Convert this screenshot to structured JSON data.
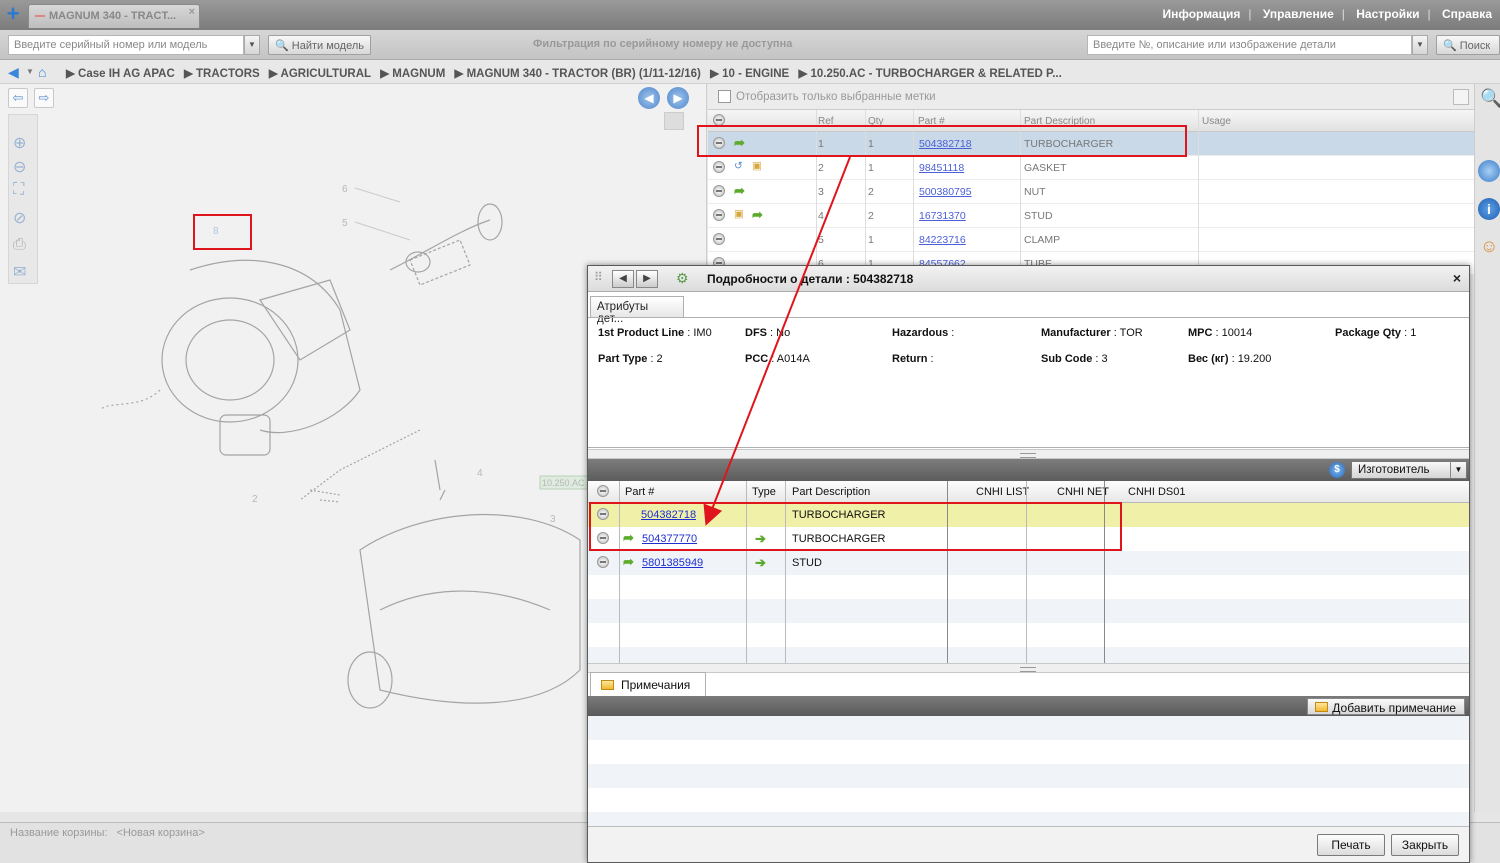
{
  "tab": {
    "title": "MAGNUM 340 - TRACT...",
    "close": "×"
  },
  "topnav": [
    "Информация",
    "Управление",
    "Настройки",
    "Справка"
  ],
  "search": {
    "serial_placeholder": "Введите серийный номер или модель",
    "find_model": "Найти модель",
    "filter_msg": "Фильтрация по серийному номеру не доступна",
    "part_placeholder": "Введите №, описание или изображение детали",
    "search_btn": "Поиск"
  },
  "breadcrumb": [
    "Case IH AG APAC",
    "TRACTORS",
    "AGRICULTURAL",
    "MAGNUM",
    "MAGNUM 340 - TRACTOR (BR) (1/11-12/16)",
    "10 - ENGINE",
    "10.250.AC - TURBOCHARGER & RELATED P..."
  ],
  "parts_list": {
    "checkbox_label": "Отобразить только выбранные метки",
    "columns": [
      "Ref",
      "Qty",
      "Part #",
      "Part Description",
      "Usage"
    ],
    "rows": [
      {
        "ref": "1",
        "qty": "1",
        "part": "504382718",
        "desc": "TURBOCHARGER"
      },
      {
        "ref": "2",
        "qty": "1",
        "part": "98451118",
        "desc": "GASKET"
      },
      {
        "ref": "3",
        "qty": "2",
        "part": "500380795",
        "desc": "NUT"
      },
      {
        "ref": "4",
        "qty": "2",
        "part": "16731370",
        "desc": "STUD"
      },
      {
        "ref": "5",
        "qty": "1",
        "part": "84223716",
        "desc": "CLAMP"
      },
      {
        "ref": "6",
        "qty": "1",
        "part": "84557662",
        "desc": "TUBE"
      }
    ]
  },
  "drawing": {
    "callouts": [
      "6",
      "5",
      "4",
      "2",
      "3"
    ],
    "label_tag": "10.250.AC",
    "marker": "8"
  },
  "basket": {
    "label": "Название корзины:",
    "value": "<Новая корзина>"
  },
  "dialog": {
    "title": "Подробности о детали : 504382718",
    "close": "×",
    "attr_tab": "Атрибуты дет...",
    "attributes": [
      {
        "label": "1st Product Line",
        "value": "IM0"
      },
      {
        "label": "DFS",
        "value": "No"
      },
      {
        "label": "Hazardous",
        "value": ""
      },
      {
        "label": "Manufacturer",
        "value": "TOR"
      },
      {
        "label": "MPC",
        "value": "10014"
      },
      {
        "label": "Package Qty",
        "value": "1"
      },
      {
        "label": "Part Type",
        "value": "2"
      },
      {
        "label": "PCC",
        "value": "A014A"
      },
      {
        "label": "Return",
        "value": ""
      },
      {
        "label": "Sub Code",
        "value": "3"
      },
      {
        "label": "Вес (кг)",
        "value": "19.200"
      }
    ],
    "manufacturer_select": "Изготовитель",
    "currency_icon": "$",
    "columns": [
      "Part #",
      "Type",
      "Part Description",
      "CNHI LIST",
      "CNHI NET",
      "CNHI DS01"
    ],
    "rows": [
      {
        "part": "504382718",
        "desc": "TURBOCHARGER",
        "highlight": true
      },
      {
        "part": "504377770",
        "desc": "TURBOCHARGER",
        "highlight": false
      },
      {
        "part": "5801385949",
        "desc": "STUD",
        "highlight": false
      }
    ],
    "notes_tab": "Примечания",
    "add_note": "Добавить примечание",
    "print": "Печать",
    "close_btn": "Закрыть"
  },
  "colors": {
    "highlight_row": "#f0f0a8",
    "selected_row": "#c9d9e8",
    "annotation": "#e0141c",
    "link": "#1d2fd0"
  }
}
